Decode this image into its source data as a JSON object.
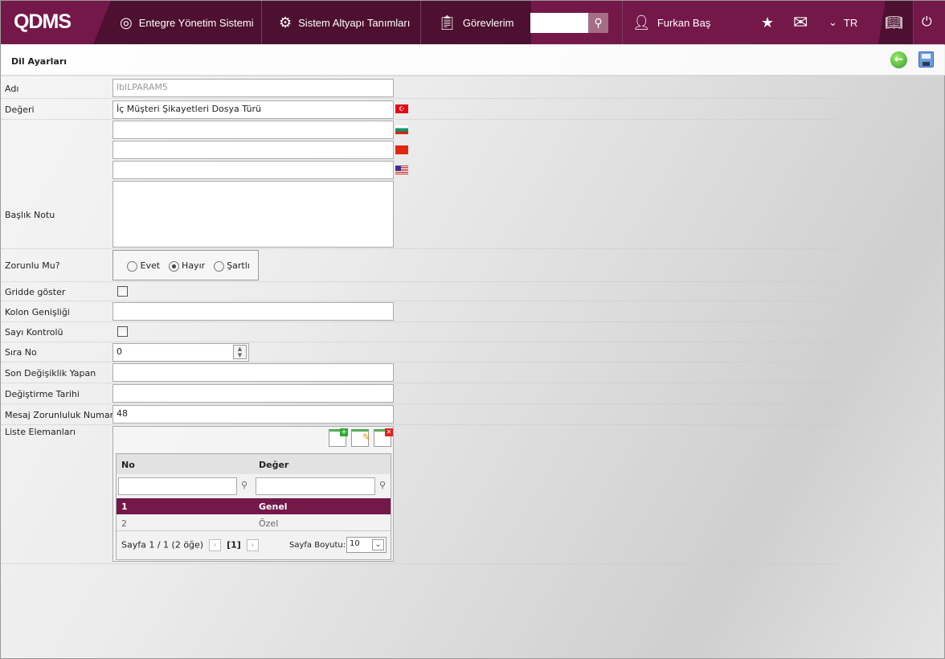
{
  "header": {
    "logo": "QDMS",
    "nav": [
      {
        "label": "Entegre Yönetim Sistemi",
        "icon": "q-logo-icon"
      },
      {
        "label": "Sistem Altyapı Tanımları",
        "icon": "gear-icon"
      },
      {
        "label": "Görevlerim",
        "icon": "clipboard-icon"
      }
    ],
    "search_value": "",
    "user": "Furkan Baş",
    "language": "TR",
    "colors": {
      "primary": "#74184a",
      "dark": "#4e1030"
    }
  },
  "page": {
    "title": "Dil Ayarları"
  },
  "form": {
    "adi_label": "Adı",
    "adi_value": "lblLPARAM5",
    "degeri_label": "Değeri",
    "degeri_tr": "İç Müşteri Şikayetleri Dosya Türü",
    "degeri_bg": "",
    "degeri_cn": "",
    "degeri_en": "",
    "baslik_label": "Başlık Notu",
    "baslik_value": "",
    "zorunlu_label": "Zorunlu Mu?",
    "zorunlu_options": [
      "Evet",
      "Hayır",
      "Şartlı"
    ],
    "zorunlu_selected": "Hayır",
    "gridde_label": "Gridde göster",
    "gridde_checked": false,
    "kolon_label": "Kolon Genişliği",
    "kolon_value": "",
    "sayi_label": "Sayı Kontrolü",
    "sayi_checked": false,
    "sira_label": "Sıra No",
    "sira_value": "0",
    "son_label": "Son Değişiklik Yapan",
    "son_value": "",
    "tarih_label": "Değiştirme Tarihi",
    "tarih_value": "",
    "mesaj_label": "Mesaj Zorunluluk Numarası",
    "mesaj_value": "48",
    "liste_label": "Liste Elemanları"
  },
  "grid": {
    "columns": [
      "No",
      "Değer"
    ],
    "rows": [
      {
        "no": "1",
        "deger": "Genel",
        "selected": true
      },
      {
        "no": "2",
        "deger": "Özel",
        "selected": false
      }
    ],
    "pager": "Sayfa 1 / 1 (2 öğe)",
    "current_page": "[1]",
    "page_size_label": "Sayfa Boyutu:",
    "page_size": "10"
  }
}
